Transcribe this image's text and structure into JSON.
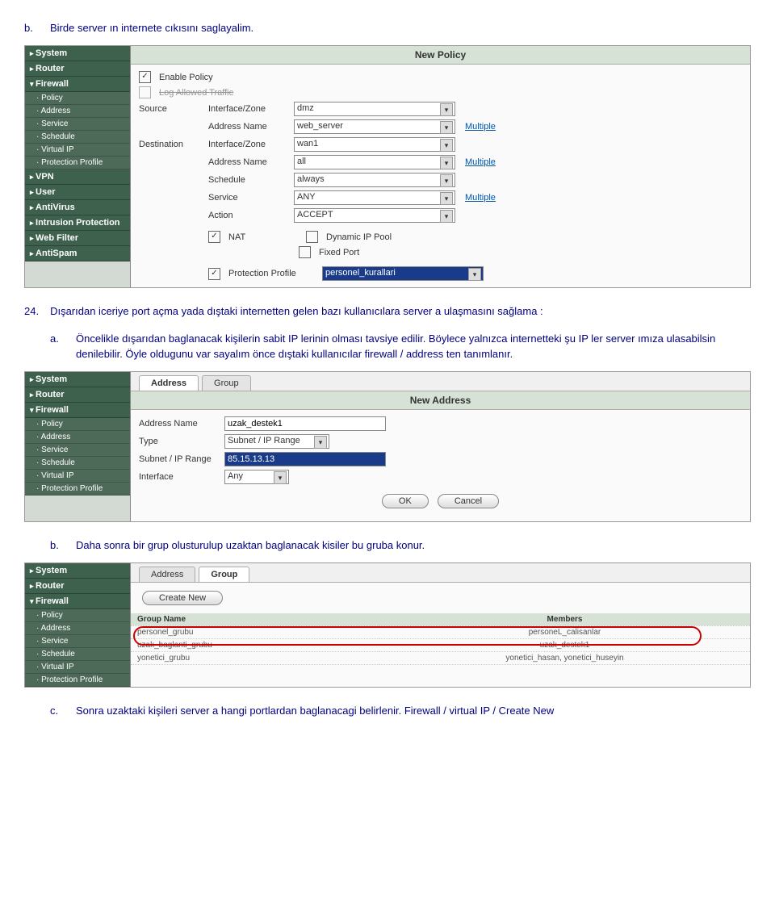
{
  "textB1": {
    "mark": "b.",
    "body": "Birde server ın internete cıkısını saglayalim."
  },
  "text24": {
    "mark": "24.",
    "body": "Dışarıdan iceriye port açma yada dıştaki internetten gelen bazı kullanıcılara server a ulaşmasını sağlama :"
  },
  "textA": {
    "mark": "a.",
    "body": "Öncelikle dışarıdan baglanacak kişilerin sabit IP lerinin olması tavsiye edilir. Böylece yalnızca internetteki şu IP ler server ımıza ulasabilsin denilebilir. Öyle oldugunu var sayalım önce dıştaki kullanıcılar firewall / address ten tanımlanır."
  },
  "textB2": {
    "mark": "b.",
    "body": "Daha sonra bir grup olusturulup uzaktan baglanacak kisiler bu gruba konur."
  },
  "textC": {
    "mark": "c.",
    "body": "Sonra uzaktaki kişileri server a hangi portlardan baglanacagi belirlenir. Firewall / virtual IP / Create New"
  },
  "nav": {
    "system": "System",
    "router": "Router",
    "firewall": "Firewall",
    "policy": "Policy",
    "address": "Address",
    "service": "Service",
    "schedule": "Schedule",
    "virtualip": "Virtual IP",
    "protprof": "Protection Profile",
    "vpn": "VPN",
    "user": "User",
    "antivirus": "AntiVirus",
    "intrusion": "Intrusion Protection",
    "webfilter": "Web Filter",
    "antispam": "AntiSpam"
  },
  "shot1": {
    "title": "New Policy",
    "enable": "Enable Policy",
    "logallowed": "Log Allowed Traffic",
    "source": "Source",
    "dest": "Destination",
    "ifzone": "Interface/Zone",
    "addrname": "Address Name",
    "schedule": "Schedule",
    "service": "Service",
    "action": "Action",
    "src_if": "dmz",
    "src_addr": "web_server",
    "dst_if": "wan1",
    "dst_addr": "all",
    "sched": "always",
    "svc": "ANY",
    "act": "ACCEPT",
    "multiple": "Multiple",
    "nat": "NAT",
    "dynpool": "Dynamic IP Pool",
    "fixedport": "Fixed Port",
    "protprof": "Protection Profile",
    "protprof_val": "personel_kurallari"
  },
  "shot2": {
    "tab_addr": "Address",
    "tab_group": "Group",
    "title": "New Address",
    "lab_name": "Address Name",
    "lab_type": "Type",
    "lab_range": "Subnet / IP Range",
    "lab_if": "Interface",
    "name": "uzak_destek1",
    "type": "Subnet / IP Range",
    "range": "85.15.13.13",
    "iface": "Any",
    "ok": "OK",
    "cancel": "Cancel"
  },
  "shot3": {
    "tab_addr": "Address",
    "tab_group": "Group",
    "create": "Create New",
    "col_name": "Group Name",
    "col_members": "Members",
    "rows": [
      {
        "name": "personel_grubu",
        "members": "personeL_calisanlar"
      },
      {
        "name": "uzak_baglanti_grubu",
        "members": "uzak_destek1"
      },
      {
        "name": "yonetici_grubu",
        "members": "yonetici_hasan, yonetici_huseyin"
      }
    ]
  }
}
